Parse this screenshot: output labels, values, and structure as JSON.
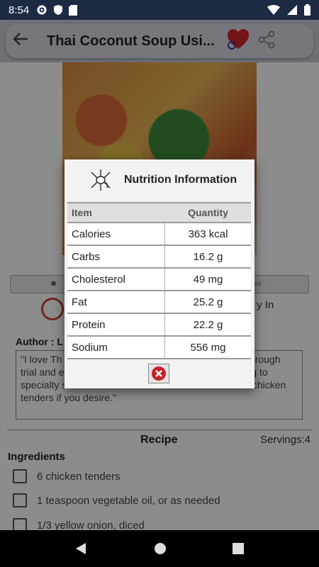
{
  "status_bar": {
    "time": "8:54",
    "icons": [
      "gear-icon",
      "shield-icon",
      "sd-card-icon"
    ],
    "right_icons": [
      "wifi-icon",
      "signal-icon",
      "battery-icon"
    ]
  },
  "app_bar": {
    "title": "Thai Coconut Soup Usi...",
    "icons": [
      "back-arrow-icon",
      "heart-icon",
      "share-icon"
    ]
  },
  "background": {
    "try_text": "y In",
    "author_label": "Author : L",
    "quote": "\"I love Th                                             the authentic                                              ed for. I invented the recipe through trial and error to make the flavors I love, without going to specialty stores. Substitute 3 chicken breasts for the chicken tenders if you desire.\"",
    "recipe_heading": "Recipe",
    "servings": "Servings:4",
    "ingredients_heading": "Ingredients",
    "ingredients": [
      "6 chicken tenders",
      "1 teaspoon vegetable oil, or as needed",
      "1/3 yellow onion, diced"
    ],
    "tab_right": "os"
  },
  "dialog": {
    "title": "Nutrition Information",
    "columns": [
      "Item",
      "Quantity"
    ],
    "rows": [
      {
        "item": "Calories",
        "quantity": "363 kcal"
      },
      {
        "item": "Carbs",
        "quantity": "16.2 g"
      },
      {
        "item": "Cholesterol",
        "quantity": "49 mg"
      },
      {
        "item": "Fat",
        "quantity": "25.2 g"
      },
      {
        "item": "Protein",
        "quantity": "22.2 g"
      },
      {
        "item": "Sodium",
        "quantity": "556 mg"
      }
    ],
    "close_icon": "close-circle-icon"
  },
  "colors": {
    "status_bar": "#1c2a44",
    "close_red": "#c8202a",
    "heart_red": "#d4262c"
  }
}
